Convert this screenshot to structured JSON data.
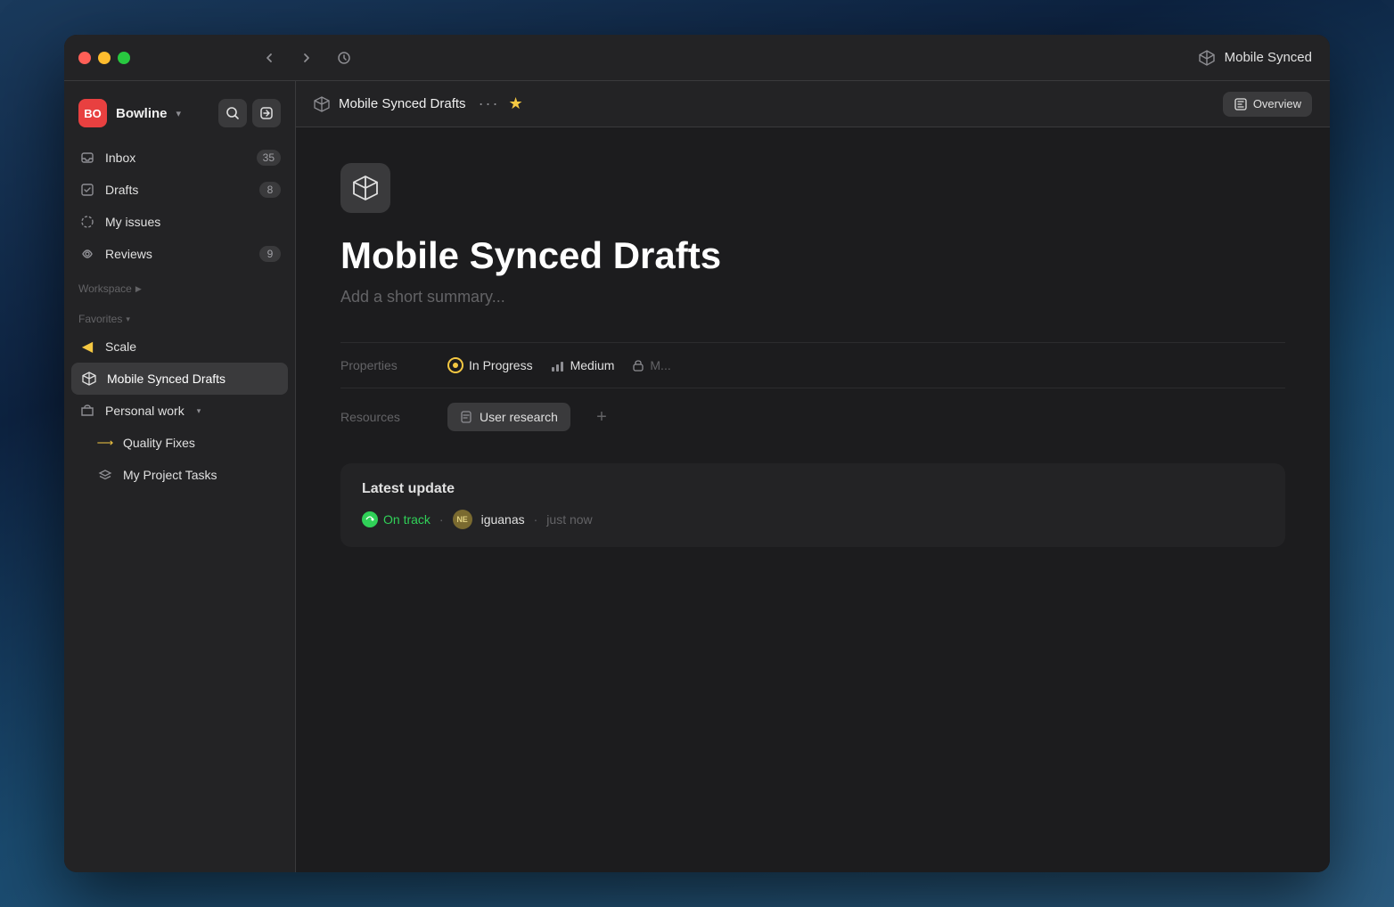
{
  "titlebar": {
    "workspace": "Mobile Synced",
    "nav_back": "←",
    "nav_forward": "→",
    "nav_history": "⏱"
  },
  "sidebar": {
    "workspace_initials": "BO",
    "workspace_name": "Bowline",
    "workspace_chevron": "▾",
    "nav_items": [
      {
        "id": "inbox",
        "label": "Inbox",
        "badge": "35",
        "icon": "inbox"
      },
      {
        "id": "drafts",
        "label": "Drafts",
        "badge": "8",
        "icon": "drafts"
      },
      {
        "id": "my-issues",
        "label": "My issues",
        "badge": "",
        "icon": "issues"
      },
      {
        "id": "reviews",
        "label": "Reviews",
        "badge": "9",
        "icon": "reviews"
      }
    ],
    "sections": {
      "workspace": "Workspace",
      "favorites": "Favorites"
    },
    "favorites": [
      {
        "id": "scale",
        "label": "Scale",
        "icon": "speaker",
        "active": false
      },
      {
        "id": "mobile-synced-drafts",
        "label": "Mobile Synced Drafts",
        "icon": "cube",
        "active": true
      },
      {
        "id": "personal-work",
        "label": "Personal work",
        "icon": "folder",
        "has_dropdown": true
      }
    ],
    "sub_items": [
      {
        "id": "quality-fixes",
        "label": "Quality Fixes",
        "icon": "arrow"
      },
      {
        "id": "my-project-tasks",
        "label": "My Project Tasks",
        "icon": "layers"
      }
    ]
  },
  "content": {
    "header": {
      "title": "Mobile Synced Drafts",
      "overview_label": "Overview"
    },
    "page": {
      "title": "Mobile Synced Drafts",
      "summary_placeholder": "Add a short summary...",
      "properties_label": "Properties",
      "status_label": "In Progress",
      "priority_label": "Medium",
      "resources_label": "Resources",
      "resource_item": "User research",
      "add_resource": "+",
      "update_section_title": "Latest update",
      "on_track_label": "On track",
      "user_initials": "NE",
      "user_name": "iguanas",
      "update_time": "just now"
    }
  }
}
